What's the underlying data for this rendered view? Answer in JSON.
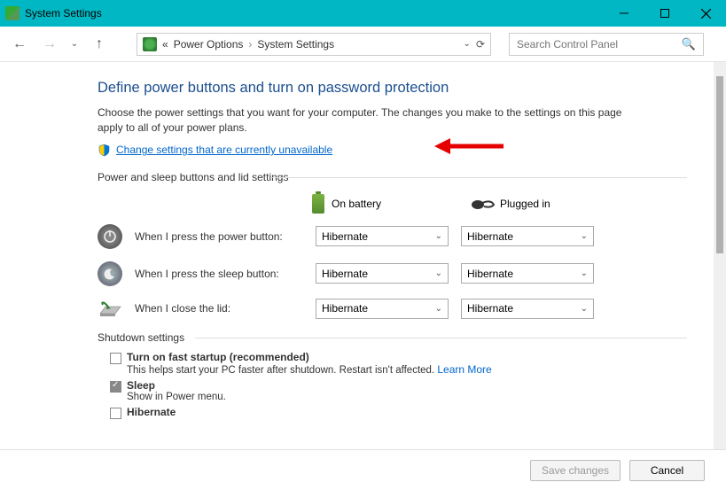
{
  "titlebar": {
    "title": "System Settings"
  },
  "breadcrumb": {
    "prefix": "«",
    "part1": "Power Options",
    "part2": "System Settings"
  },
  "search": {
    "placeholder": "Search Control Panel"
  },
  "main": {
    "heading": "Define power buttons and turn on password protection",
    "subtext": "Choose the power settings that you want for your computer. The changes you make to the settings on this page apply to all of your power plans.",
    "change_link": "Change settings that are currently unavailable",
    "section1": "Power and sleep buttons and lid settings",
    "col_battery": "On battery",
    "col_plugged": "Plugged in",
    "rows": [
      {
        "label": "When I press the power button:",
        "battery": "Hibernate",
        "plugged": "Hibernate"
      },
      {
        "label": "When I press the sleep button:",
        "battery": "Hibernate",
        "plugged": "Hibernate"
      },
      {
        "label": "When I close the lid:",
        "battery": "Hibernate",
        "plugged": "Hibernate"
      }
    ],
    "section2": "Shutdown settings",
    "shutdown": [
      {
        "label": "Turn on fast startup (recommended)",
        "sub": "This helps start your PC faster after shutdown. Restart isn't affected. ",
        "learn": "Learn More",
        "checked": false
      },
      {
        "label": "Sleep",
        "sub": "Show in Power menu.",
        "checked": true
      },
      {
        "label": "Hibernate",
        "sub": "",
        "checked": false
      }
    ]
  },
  "footer": {
    "save": "Save changes",
    "cancel": "Cancel"
  }
}
